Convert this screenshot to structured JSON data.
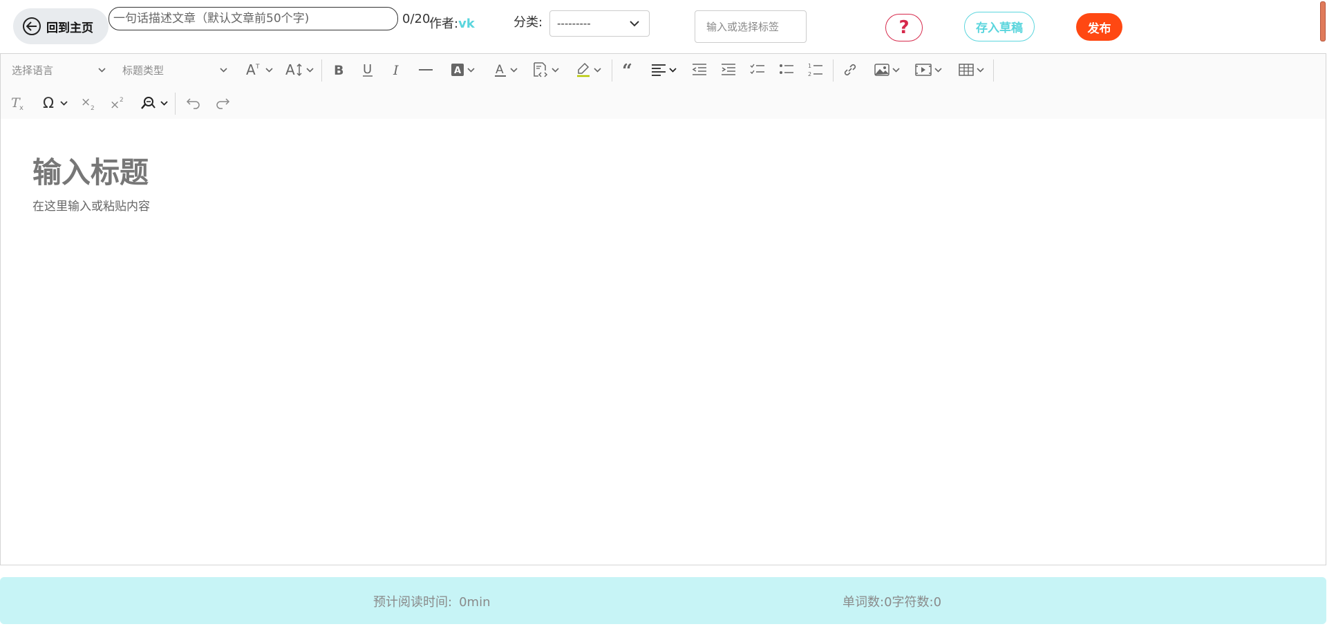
{
  "header": {
    "home_label": "回到主页",
    "summary_placeholder": "一句话描述文章（默认文章前50个字)",
    "summary_value": "",
    "char_count": "0/20",
    "author_label": "作者:",
    "author_name": "vk",
    "category_label": "分类:",
    "category_selected": "---------",
    "tag_placeholder": "输入或选择标签",
    "help_label": "?",
    "draft_label": "存入草稿",
    "publish_label": "发布"
  },
  "toolbar": {
    "language_select": "选择语言",
    "heading_select": "标题类型",
    "icons_row1": [
      "font-size-icon",
      "line-height-icon",
      "bold-icon",
      "underline-icon",
      "italic-icon",
      "horizontal-line-icon",
      "font-background-color-icon",
      "font-color-icon",
      "code-block-icon",
      "highlight-icon",
      "blockquote-icon",
      "align-icon",
      "outdent-icon",
      "indent-icon",
      "todo-list-icon",
      "bulleted-list-icon",
      "numbered-list-icon",
      "link-icon",
      "image-icon",
      "media-icon",
      "table-icon"
    ],
    "icons_row2": [
      "remove-format-icon",
      "special-characters-icon",
      "subscript-icon",
      "superscript-icon",
      "find-replace-icon",
      "undo-icon",
      "redo-icon"
    ]
  },
  "editor": {
    "title_placeholder": "输入标题",
    "body_placeholder": "在这里输入或粘贴内容"
  },
  "status": {
    "reading_label": "预计阅读时间:",
    "reading_value": "0min",
    "word_label": "单词数:",
    "word_value": "0",
    "char_label": "字符数:",
    "char_value": "0"
  },
  "colors": {
    "accent": "#5ad5dd",
    "publish": "#ff4812",
    "help": "#d6284a",
    "status_bg": "#c7f4f6"
  }
}
